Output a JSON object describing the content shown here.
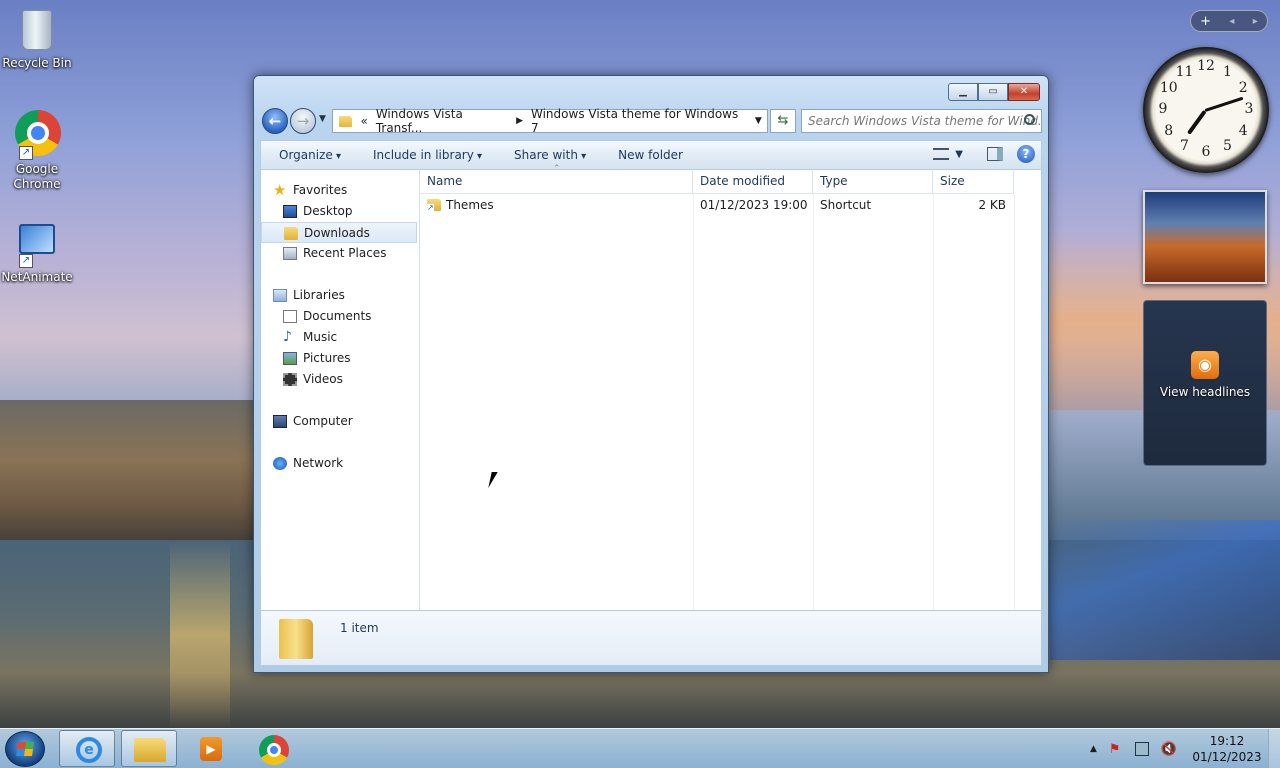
{
  "desktop": {
    "icons": [
      {
        "label": "Recycle Bin"
      },
      {
        "label": "Google Chrome"
      },
      {
        "label": "NetAnimate"
      }
    ],
    "gadgets": {
      "clock_numbers": [
        "12",
        "1",
        "2",
        "3",
        "4",
        "5",
        "6",
        "7",
        "8",
        "9",
        "10",
        "11"
      ],
      "feed_label": "View headlines"
    }
  },
  "window": {
    "address": {
      "crumb_overflow": "«",
      "crumb_1": "Windows Vista Transf...",
      "crumb_2": "Windows Vista theme for Windows 7"
    },
    "search_placeholder": "Search Windows Vista theme for Wind...",
    "toolbar": {
      "organize": "Organize",
      "include_in_library": "Include in library",
      "share_with": "Share with",
      "new_folder": "New folder"
    },
    "nav": {
      "favorites": "Favorites",
      "desktop": "Desktop",
      "downloads": "Downloads",
      "recent_places": "Recent Places",
      "libraries": "Libraries",
      "documents": "Documents",
      "music": "Music",
      "pictures": "Pictures",
      "videos": "Videos",
      "computer": "Computer",
      "network": "Network"
    },
    "columns": {
      "name": "Name",
      "date_modified": "Date modified",
      "type": "Type",
      "size": "Size"
    },
    "files": [
      {
        "name": "Themes",
        "date_modified": "01/12/2023 19:00",
        "type": "Shortcut",
        "size": "2 KB"
      }
    ],
    "details": {
      "item_count": "1 item"
    }
  },
  "taskbar": {
    "time": "19:12",
    "date": "01/12/2023"
  },
  "colors": {
    "accent": "#1e395b",
    "selection": "#dbe8f6",
    "close_button": "#c4412c"
  }
}
